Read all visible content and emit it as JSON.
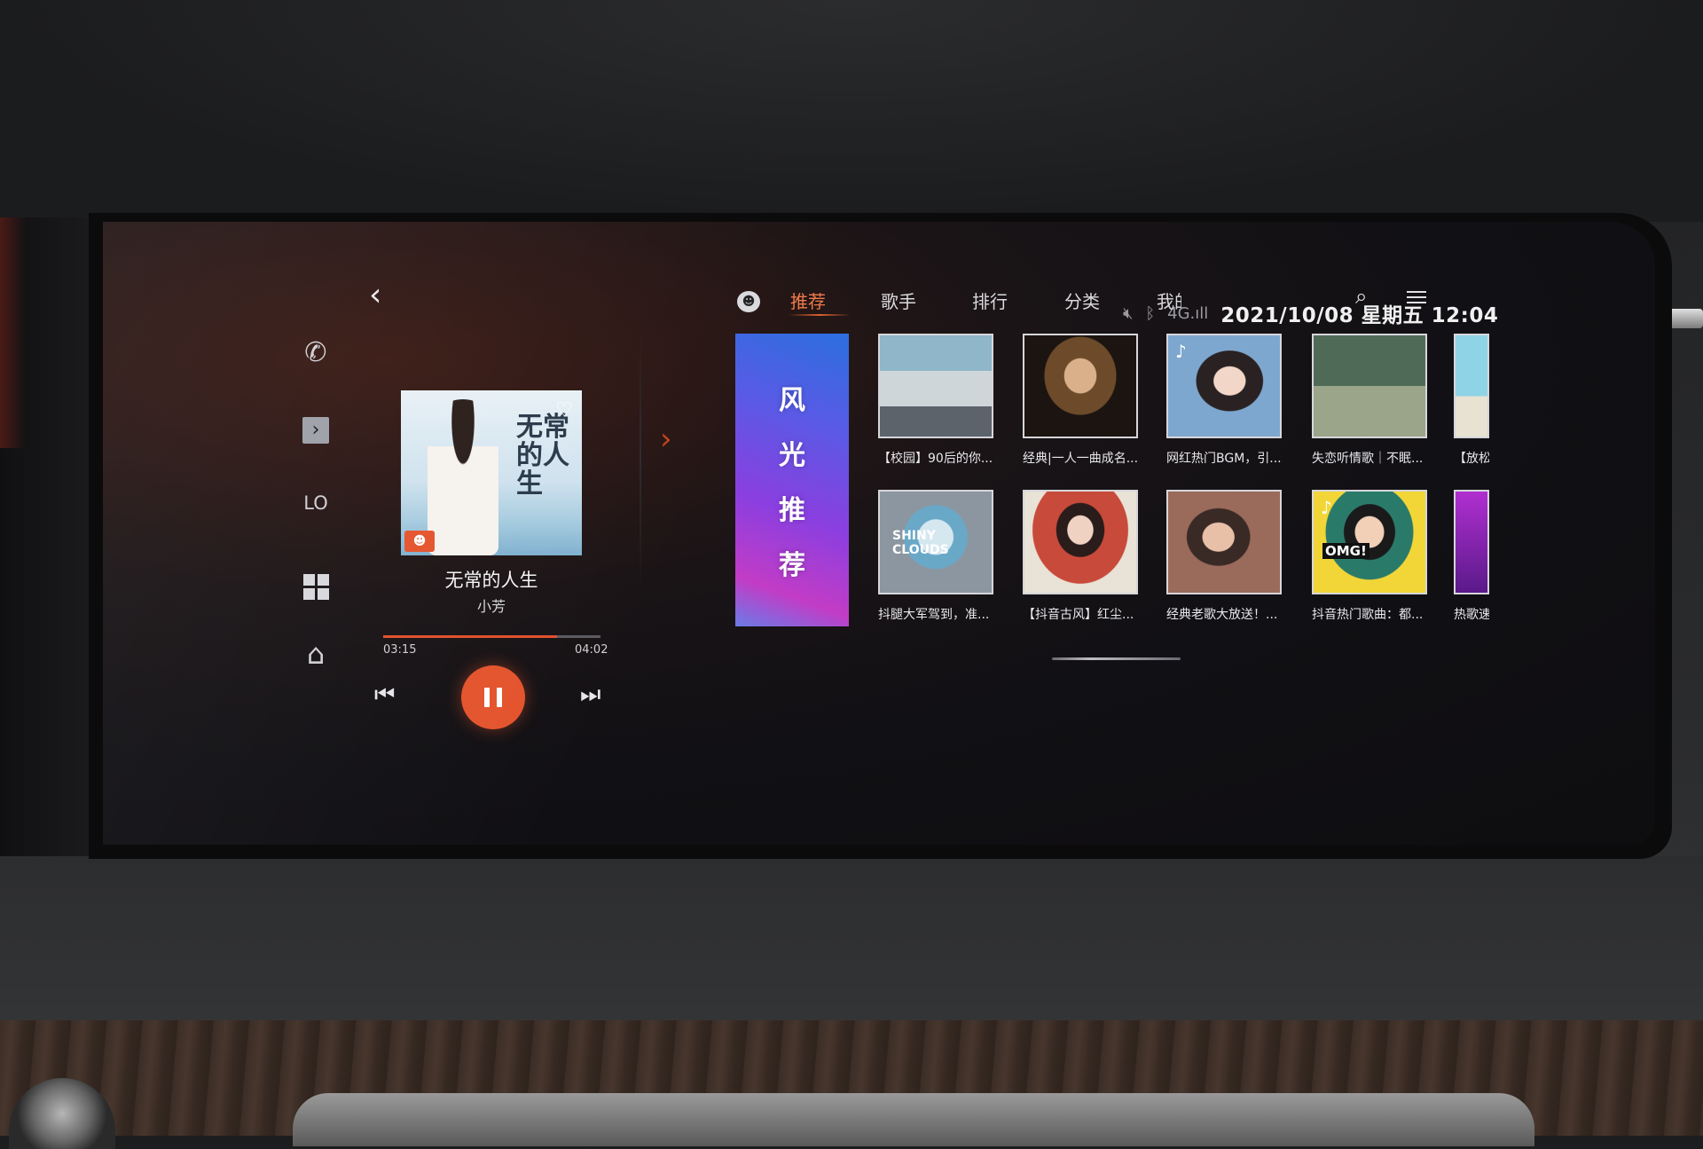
{
  "status": {
    "mute_icon": "speaker-mute-icon",
    "bluetooth_icon": "bluetooth-icon",
    "signal": "4G.ıll",
    "datetime": "2021/10/08 星期五 12:04"
  },
  "rail": {
    "lo_label": "LO"
  },
  "player": {
    "cover_title": "无常的人生",
    "song_title": "无常的人生",
    "artist": "小芳",
    "current_time": "03:15",
    "duration": "04:02",
    "progress": 0.8
  },
  "tabs": [
    {
      "label": "推荐",
      "active": true
    },
    {
      "label": "歌手",
      "active": false
    },
    {
      "label": "排行",
      "active": false
    },
    {
      "label": "分类",
      "active": false
    },
    {
      "label": "我的",
      "active": false
    }
  ],
  "banner": {
    "chars": [
      "风",
      "光",
      "推",
      "荐"
    ]
  },
  "playlists_row1": [
    {
      "caption": "【校园】90后的你..."
    },
    {
      "caption": "经典|一人一曲成名..."
    },
    {
      "caption": "网红热门BGM，引..."
    },
    {
      "caption": "失恋听情歌｜不眠..."
    },
    {
      "caption": "【放松"
    }
  ],
  "playlists_row2": [
    {
      "caption": "抖腿大军驾到，准...",
      "thumb_text": "SHINY CLOUDS"
    },
    {
      "caption": "【抖音古风】红尘..."
    },
    {
      "caption": "经典老歌大放送！..."
    },
    {
      "caption": "抖音热门歌曲：都...",
      "thumb_text": "OMG!"
    },
    {
      "caption": "热歌速"
    }
  ],
  "colors": {
    "accent": "#e4542d",
    "tab_active": "#ef7a4a"
  }
}
